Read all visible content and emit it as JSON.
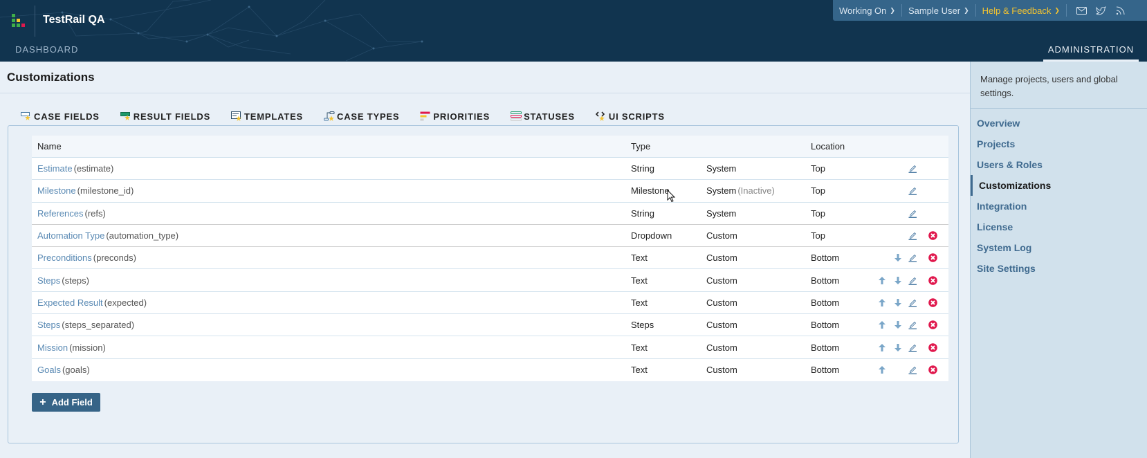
{
  "header": {
    "app_title": "TestRail QA",
    "nav": {
      "dashboard": "DASHBOARD",
      "administration": "ADMINISTRATION"
    },
    "topbar": {
      "working_on": "Working On",
      "user": "Sample User",
      "help": "Help & Feedback",
      "icons": [
        "mail-icon",
        "twitter-icon",
        "rss-icon"
      ]
    },
    "colors": {
      "header_bg": "#11344f",
      "topbar_bg": "#35658a",
      "help_accent": "#f4c430"
    }
  },
  "page": {
    "title": "Customizations",
    "tabs": [
      {
        "label": "CASE FIELDS",
        "icon": "case-fields-icon",
        "active": true
      },
      {
        "label": "RESULT FIELDS",
        "icon": "result-fields-icon",
        "active": false
      },
      {
        "label": "TEMPLATES",
        "icon": "templates-icon",
        "active": false
      },
      {
        "label": "CASE TYPES",
        "icon": "case-types-icon",
        "active": false
      },
      {
        "label": "PRIORITIES",
        "icon": "priorities-icon",
        "active": false
      },
      {
        "label": "STATUSES",
        "icon": "statuses-icon",
        "active": false
      },
      {
        "label": "UI SCRIPTS",
        "icon": "ui-scripts-icon",
        "active": false
      }
    ]
  },
  "table": {
    "headers": {
      "name": "Name",
      "type": "Type",
      "location": "Location"
    },
    "rows": [
      {
        "label": "Estimate",
        "system_name": "(estimate)",
        "type": "String",
        "source": "System",
        "inactive": "",
        "location": "Top",
        "up": false,
        "down": false,
        "edit": true,
        "delete": false
      },
      {
        "label": "Milestone",
        "system_name": "(milestone_id)",
        "type": "Milestone",
        "source": "System",
        "inactive": "(Inactive)",
        "location": "Top",
        "up": false,
        "down": false,
        "edit": true,
        "delete": false
      },
      {
        "label": "References",
        "system_name": "(refs)",
        "type": "String",
        "source": "System",
        "inactive": "",
        "location": "Top",
        "up": false,
        "down": false,
        "edit": true,
        "delete": false
      },
      {
        "label": "Automation Type",
        "system_name": "(automation_type)",
        "type": "Dropdown",
        "source": "Custom",
        "inactive": "",
        "location": "Top",
        "up": false,
        "down": false,
        "edit": true,
        "delete": true
      },
      {
        "label": "Preconditions",
        "system_name": "(preconds)",
        "type": "Text",
        "source": "Custom",
        "inactive": "",
        "location": "Bottom",
        "up": false,
        "down": true,
        "edit": true,
        "delete": true
      },
      {
        "label": "Steps",
        "system_name": "(steps)",
        "type": "Text",
        "source": "Custom",
        "inactive": "",
        "location": "Bottom",
        "up": true,
        "down": true,
        "edit": true,
        "delete": true
      },
      {
        "label": "Expected Result",
        "system_name": "(expected)",
        "type": "Text",
        "source": "Custom",
        "inactive": "",
        "location": "Bottom",
        "up": true,
        "down": true,
        "edit": true,
        "delete": true
      },
      {
        "label": "Steps",
        "system_name": "(steps_separated)",
        "type": "Steps",
        "source": "Custom",
        "inactive": "",
        "location": "Bottom",
        "up": true,
        "down": true,
        "edit": true,
        "delete": true
      },
      {
        "label": "Mission",
        "system_name": "(mission)",
        "type": "Text",
        "source": "Custom",
        "inactive": "",
        "location": "Bottom",
        "up": true,
        "down": true,
        "edit": true,
        "delete": true
      },
      {
        "label": "Goals",
        "system_name": "(goals)",
        "type": "Text",
        "source": "Custom",
        "inactive": "",
        "location": "Bottom",
        "up": true,
        "down": false,
        "edit": true,
        "delete": true
      }
    ],
    "add_button": "Add Field"
  },
  "sidebar": {
    "description": "Manage projects, users and global settings.",
    "items": [
      {
        "label": "Overview",
        "active": false
      },
      {
        "label": "Projects",
        "active": false
      },
      {
        "label": "Users & Roles",
        "active": false
      },
      {
        "label": "Customizations",
        "active": true
      },
      {
        "label": "Integration",
        "active": false
      },
      {
        "label": "License",
        "active": false
      },
      {
        "label": "System Log",
        "active": false
      },
      {
        "label": "Site Settings",
        "active": false
      }
    ]
  }
}
